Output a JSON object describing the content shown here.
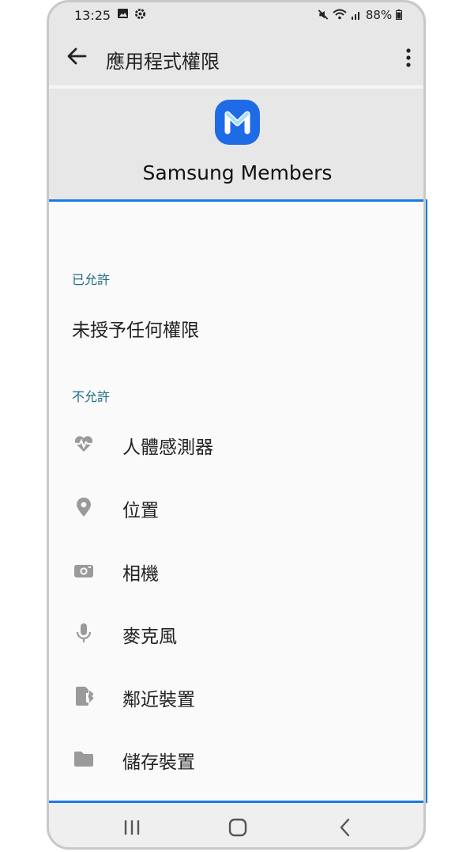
{
  "status_bar": {
    "time": "13:25",
    "battery": "88%"
  },
  "app_bar": {
    "title": "應用程式權限"
  },
  "app": {
    "name": "Samsung Members"
  },
  "sections": {
    "allowed_header": "已允許",
    "allowed_empty": "未授予任何權限",
    "denied_header": "不允許"
  },
  "permissions": [
    {
      "label": "人體感測器",
      "icon": "heart-rate-icon"
    },
    {
      "label": "位置",
      "icon": "location-pin-icon"
    },
    {
      "label": "相機",
      "icon": "camera-icon"
    },
    {
      "label": "麥克風",
      "icon": "microphone-icon"
    },
    {
      "label": "鄰近裝置",
      "icon": "nearby-devices-icon"
    },
    {
      "label": "儲存裝置",
      "icon": "folder-icon"
    }
  ],
  "colors": {
    "highlight_border": "#1a7be6",
    "section_header": "#1d6b88",
    "app_icon": "#1f6be6",
    "icon_gray": "#9a9a9a"
  }
}
